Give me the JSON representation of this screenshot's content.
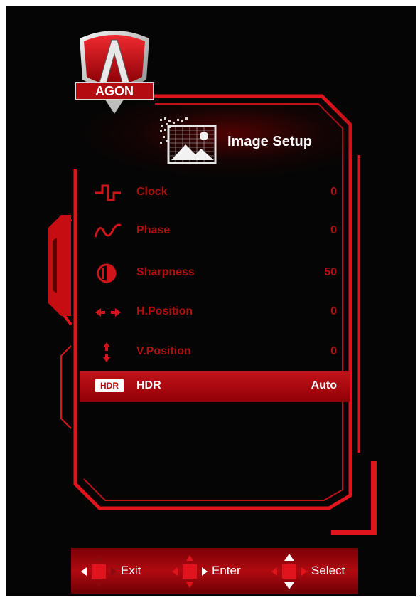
{
  "header": {
    "title": "Image Setup",
    "icon": "image-setup-icon"
  },
  "logo": {
    "text": "AGON"
  },
  "menu": [
    {
      "label": "Clock",
      "value": "0",
      "icon": "clock-wave-icon"
    },
    {
      "label": "Phase",
      "value": "0",
      "icon": "phase-wave-icon"
    },
    {
      "label": "Sharpness",
      "value": "50",
      "icon": "sharpness-icon"
    },
    {
      "label": "H.Position",
      "value": "0",
      "icon": "horizontal-arrows-icon"
    },
    {
      "label": "V.Position",
      "value": "0",
      "icon": "vertical-arrows-icon"
    },
    {
      "label": "HDR",
      "value": "Auto",
      "icon": "hdr-icon",
      "badge": "HDR",
      "selected": true
    }
  ],
  "footer": {
    "exit_label": "Exit",
    "enter_label": "Enter",
    "select_label": "Select"
  },
  "colors": {
    "accent": "#e0141c",
    "inactive_text": "#b00f0f",
    "background": "#050505"
  }
}
